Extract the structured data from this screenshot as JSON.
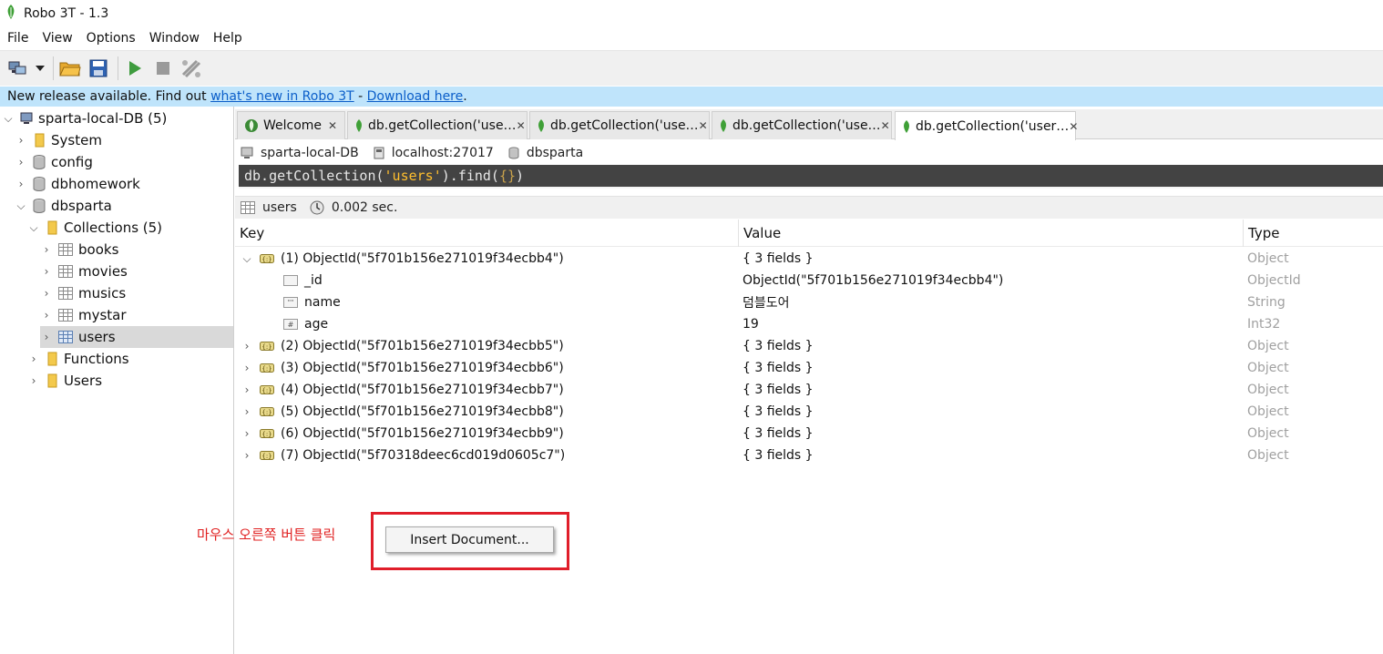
{
  "window": {
    "title": "Robo 3T - 1.3"
  },
  "menu": [
    "File",
    "View",
    "Options",
    "Window",
    "Help"
  ],
  "toolbar": {
    "icons": [
      "connect-icon",
      "dropdown-arrow-icon",
      "open-folder-icon",
      "save-icon",
      "run-icon",
      "stop-icon",
      "format-icon"
    ]
  },
  "notice": {
    "prefix": "New release available. Find out ",
    "link1": "what's new in Robo 3T",
    "middle": " - ",
    "link2": "Download here",
    "suffix": "."
  },
  "sidebar": {
    "connection": "sparta-local-DB (5)",
    "items": [
      {
        "label": "System"
      },
      {
        "label": "config"
      },
      {
        "label": "dbhomework"
      },
      {
        "label": "dbsparta"
      },
      {
        "label": "Collections (5)"
      },
      {
        "label": "books"
      },
      {
        "label": "movies"
      },
      {
        "label": "musics"
      },
      {
        "label": "mystar"
      },
      {
        "label": "users"
      },
      {
        "label": "Functions"
      },
      {
        "label": "Users"
      }
    ]
  },
  "tabs": [
    {
      "label": "Welcome"
    },
    {
      "label": "db.getCollection('use…"
    },
    {
      "label": "db.getCollection('use…"
    },
    {
      "label": "db.getCollection('use…"
    },
    {
      "label": "db.getCollection('user…"
    }
  ],
  "conninfo": {
    "connection": "sparta-local-DB",
    "host": "localhost:27017",
    "db": "dbsparta"
  },
  "query": {
    "p1": "db.getCollection(",
    "str": "'users'",
    "p2": ").find(",
    "braces": "{}",
    "p3": ")"
  },
  "result": {
    "collection": "users",
    "time": "0.002 sec."
  },
  "grid": {
    "headers": {
      "key": "Key",
      "value": "Value",
      "type": "Type"
    },
    "rows": [
      {
        "key": "(1) ObjectId(\"5f701b156e271019f34ecbb4\")",
        "value": "{ 3 fields }",
        "type": "Object",
        "expanded": true
      },
      {
        "key": "_id",
        "value": "ObjectId(\"5f701b156e271019f34ecbb4\")",
        "type": "ObjectId",
        "child": true
      },
      {
        "key": "name",
        "value": "덤블도어",
        "type": "String",
        "child": true
      },
      {
        "key": "age",
        "value": "19",
        "type": "Int32",
        "child": true
      },
      {
        "key": "(2) ObjectId(\"5f701b156e271019f34ecbb5\")",
        "value": "{ 3 fields }",
        "type": "Object"
      },
      {
        "key": "(3) ObjectId(\"5f701b156e271019f34ecbb6\")",
        "value": "{ 3 fields }",
        "type": "Object"
      },
      {
        "key": "(4) ObjectId(\"5f701b156e271019f34ecbb7\")",
        "value": "{ 3 fields }",
        "type": "Object"
      },
      {
        "key": "(5) ObjectId(\"5f701b156e271019f34ecbb8\")",
        "value": "{ 3 fields }",
        "type": "Object"
      },
      {
        "key": "(6) ObjectId(\"5f701b156e271019f34ecbb9\")",
        "value": "{ 3 fields }",
        "type": "Object"
      },
      {
        "key": "(7) ObjectId(\"5f70318deec6cd019d0605c7\")",
        "value": "{ 3 fields }",
        "type": "Object"
      }
    ]
  },
  "annotation": "마우스 오른쪽 버튼 클릭",
  "context_menu": {
    "insert_label": "Insert Document..."
  },
  "colors": {
    "accent_red": "#e01e2a",
    "notice_bg": "#bfe4fb",
    "link": "#0b5ec9",
    "leaf_green": "#3fa037"
  }
}
